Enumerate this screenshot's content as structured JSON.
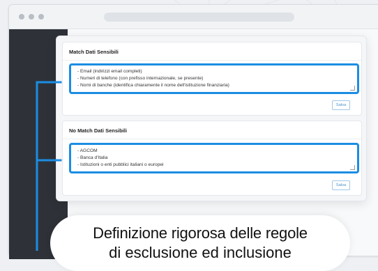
{
  "cards": [
    {
      "title": "Match Dati Sensibili",
      "lines": [
        "- Email (indirizzi email completi)",
        "- Numeri di telefono (con prefisso internazionale, se presente)",
        "- Nomi di banche (identifica chiaramente il nome dell'istituzione finanziaria)"
      ],
      "save_label": "Salva"
    },
    {
      "title": "No Match Dati Sensibili",
      "lines": [
        "- AGCOM",
        "- Banca d'Italia",
        "- Istituzioni o enti pubblici italiani o europei"
      ],
      "save_label": "Salva"
    }
  ],
  "caption": {
    "line1": "Definizione rigorosa delle regole",
    "line2": "di esclusione ed inclusione"
  },
  "colors": {
    "accent": "#1b8de3",
    "sidebar": "#2e3238"
  }
}
